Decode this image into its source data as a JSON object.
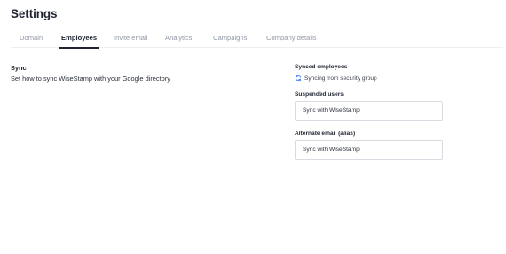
{
  "page": {
    "title": "Settings"
  },
  "tabs": [
    {
      "label": "Domain",
      "active": false
    },
    {
      "label": "Employees",
      "active": true
    },
    {
      "label": "Invite email",
      "active": false
    },
    {
      "label": "Analytics",
      "active": false
    },
    {
      "label": "Campaigns",
      "active": false
    },
    {
      "label": "Company details",
      "active": false
    }
  ],
  "sync_section": {
    "title": "Sync",
    "description": "Set how to sync WiseStamp with your Google directory"
  },
  "synced_employees": {
    "label": "Synced employees",
    "status_icon": "sync-icon",
    "status_text": "Syncing from security group",
    "status_color": "#3b82f6"
  },
  "suspended_users": {
    "label": "Suspended users",
    "value": "Sync with WiseStamp"
  },
  "alternate_email": {
    "label": "Alternate email (alias)",
    "value": "Sync with WiseStamp"
  }
}
